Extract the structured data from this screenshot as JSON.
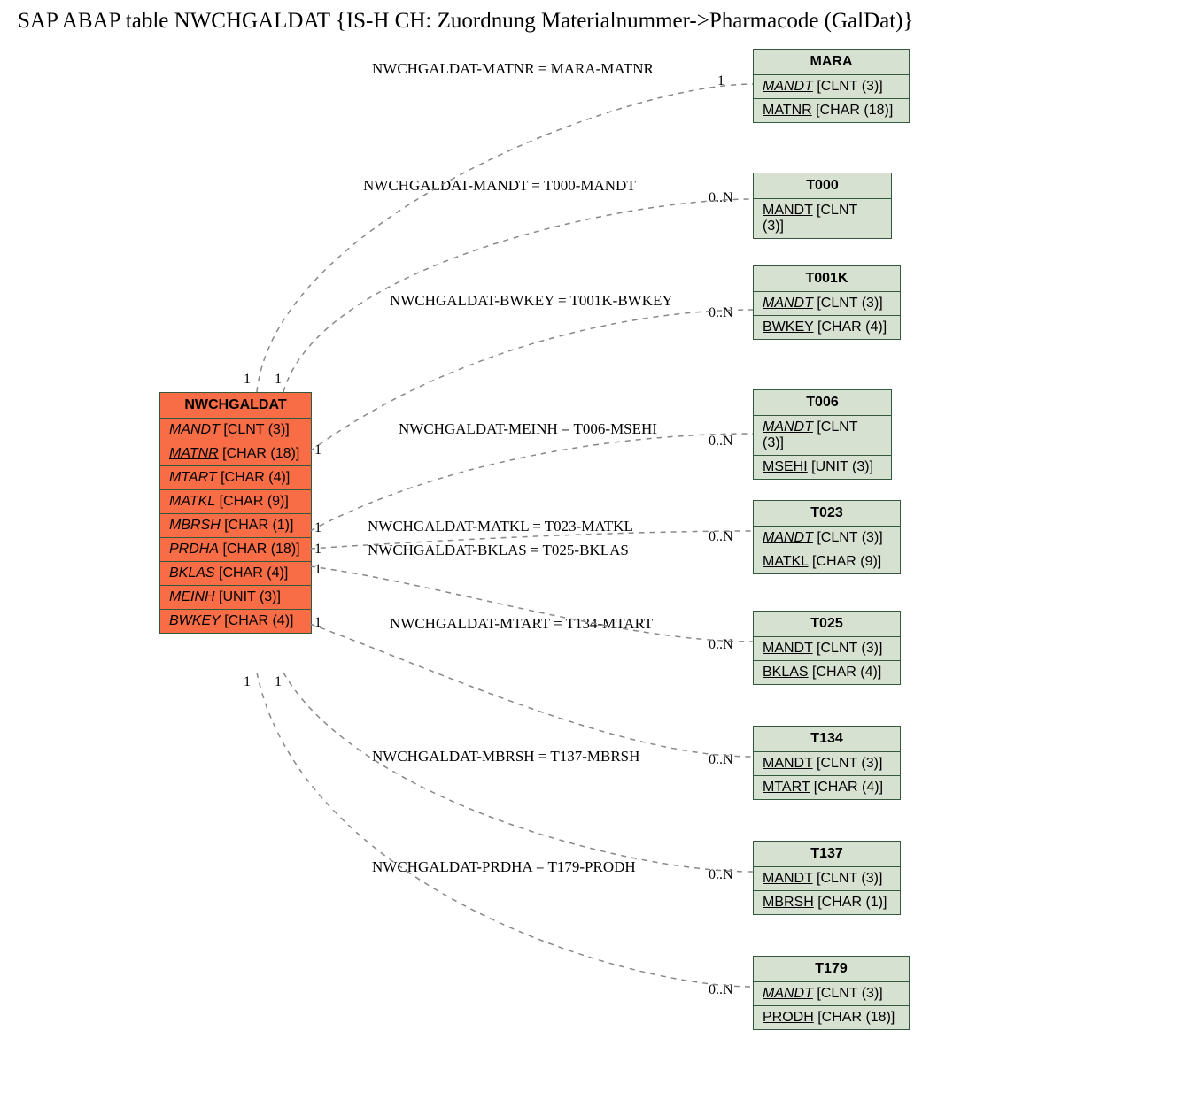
{
  "title": "SAP ABAP table NWCHGALDAT {IS-H CH: Zuordnung Materialnummer->Pharmacode (GalDat)}",
  "mainEntity": {
    "name": "NWCHGALDAT",
    "fields": [
      {
        "name": "MANDT",
        "type": "[CLNT (3)]",
        "italic": true,
        "underline": true
      },
      {
        "name": "MATNR",
        "type": "[CHAR (18)]",
        "italic": true,
        "underline": true
      },
      {
        "name": "MTART",
        "type": "[CHAR (4)]",
        "italic": true,
        "underline": false
      },
      {
        "name": "MATKL",
        "type": "[CHAR (9)]",
        "italic": true,
        "underline": false
      },
      {
        "name": "MBRSH",
        "type": "[CHAR (1)]",
        "italic": true,
        "underline": false
      },
      {
        "name": "PRDHA",
        "type": "[CHAR (18)]",
        "italic": true,
        "underline": false
      },
      {
        "name": "BKLAS",
        "type": "[CHAR (4)]",
        "italic": true,
        "underline": false
      },
      {
        "name": "MEINH",
        "type": "[UNIT (3)]",
        "italic": true,
        "underline": false
      },
      {
        "name": "BWKEY",
        "type": "[CHAR (4)]",
        "italic": true,
        "underline": false
      }
    ]
  },
  "refEntities": [
    {
      "name": "MARA",
      "fields": [
        {
          "name": "MANDT",
          "type": "[CLNT (3)]",
          "italic": true,
          "underline": true
        },
        {
          "name": "MATNR",
          "type": "[CHAR (18)]",
          "italic": false,
          "underline": true
        }
      ]
    },
    {
      "name": "T000",
      "fields": [
        {
          "name": "MANDT",
          "type": "[CLNT (3)]",
          "italic": false,
          "underline": true
        }
      ]
    },
    {
      "name": "T001K",
      "fields": [
        {
          "name": "MANDT",
          "type": "[CLNT (3)]",
          "italic": true,
          "underline": true
        },
        {
          "name": "BWKEY",
          "type": "[CHAR (4)]",
          "italic": false,
          "underline": true
        }
      ]
    },
    {
      "name": "T006",
      "fields": [
        {
          "name": "MANDT",
          "type": "[CLNT (3)]",
          "italic": true,
          "underline": true
        },
        {
          "name": "MSEHI",
          "type": "[UNIT (3)]",
          "italic": false,
          "underline": true
        }
      ]
    },
    {
      "name": "T023",
      "fields": [
        {
          "name": "MANDT",
          "type": "[CLNT (3)]",
          "italic": true,
          "underline": true
        },
        {
          "name": "MATKL",
          "type": "[CHAR (9)]",
          "italic": false,
          "underline": true
        }
      ]
    },
    {
      "name": "T025",
      "fields": [
        {
          "name": "MANDT",
          "type": "[CLNT (3)]",
          "italic": false,
          "underline": true
        },
        {
          "name": "BKLAS",
          "type": "[CHAR (4)]",
          "italic": false,
          "underline": true
        }
      ]
    },
    {
      "name": "T134",
      "fields": [
        {
          "name": "MANDT",
          "type": "[CLNT (3)]",
          "italic": false,
          "underline": true
        },
        {
          "name": "MTART",
          "type": "[CHAR (4)]",
          "italic": false,
          "underline": true
        }
      ]
    },
    {
      "name": "T137",
      "fields": [
        {
          "name": "MANDT",
          "type": "[CLNT (3)]",
          "italic": false,
          "underline": true
        },
        {
          "name": "MBRSH",
          "type": "[CHAR (1)]",
          "italic": false,
          "underline": true
        }
      ]
    },
    {
      "name": "T179",
      "fields": [
        {
          "name": "MANDT",
          "type": "[CLNT (3)]",
          "italic": true,
          "underline": true
        },
        {
          "name": "PRODH",
          "type": "[CHAR (18)]",
          "italic": false,
          "underline": true
        }
      ]
    }
  ],
  "relations": [
    {
      "label": "NWCHGALDAT-MATNR = MARA-MATNR",
      "rightCard": "1"
    },
    {
      "label": "NWCHGALDAT-MANDT = T000-MANDT",
      "rightCard": "0..N"
    },
    {
      "label": "NWCHGALDAT-BWKEY = T001K-BWKEY",
      "rightCard": "0..N"
    },
    {
      "label": "NWCHGALDAT-MEINH = T006-MSEHI",
      "rightCard": "0..N"
    },
    {
      "label": "NWCHGALDAT-MATKL = T023-MATKL",
      "rightCard": "0..N"
    },
    {
      "label": "NWCHGALDAT-BKLAS = T025-BKLAS",
      "rightCard": ""
    },
    {
      "label": "NWCHGALDAT-MTART = T134-MTART",
      "rightCard": "0..N"
    },
    {
      "label": "NWCHGALDAT-MBRSH = T137-MBRSH",
      "rightCard": "0..N"
    },
    {
      "label": "NWCHGALDAT-PRDHA = T179-PRODH",
      "rightCard": "0..N"
    }
  ],
  "leftCards": [
    "1",
    "1",
    "1",
    "1",
    "1",
    "1",
    "1",
    "1",
    "1"
  ],
  "extraRightCard": "0..N"
}
